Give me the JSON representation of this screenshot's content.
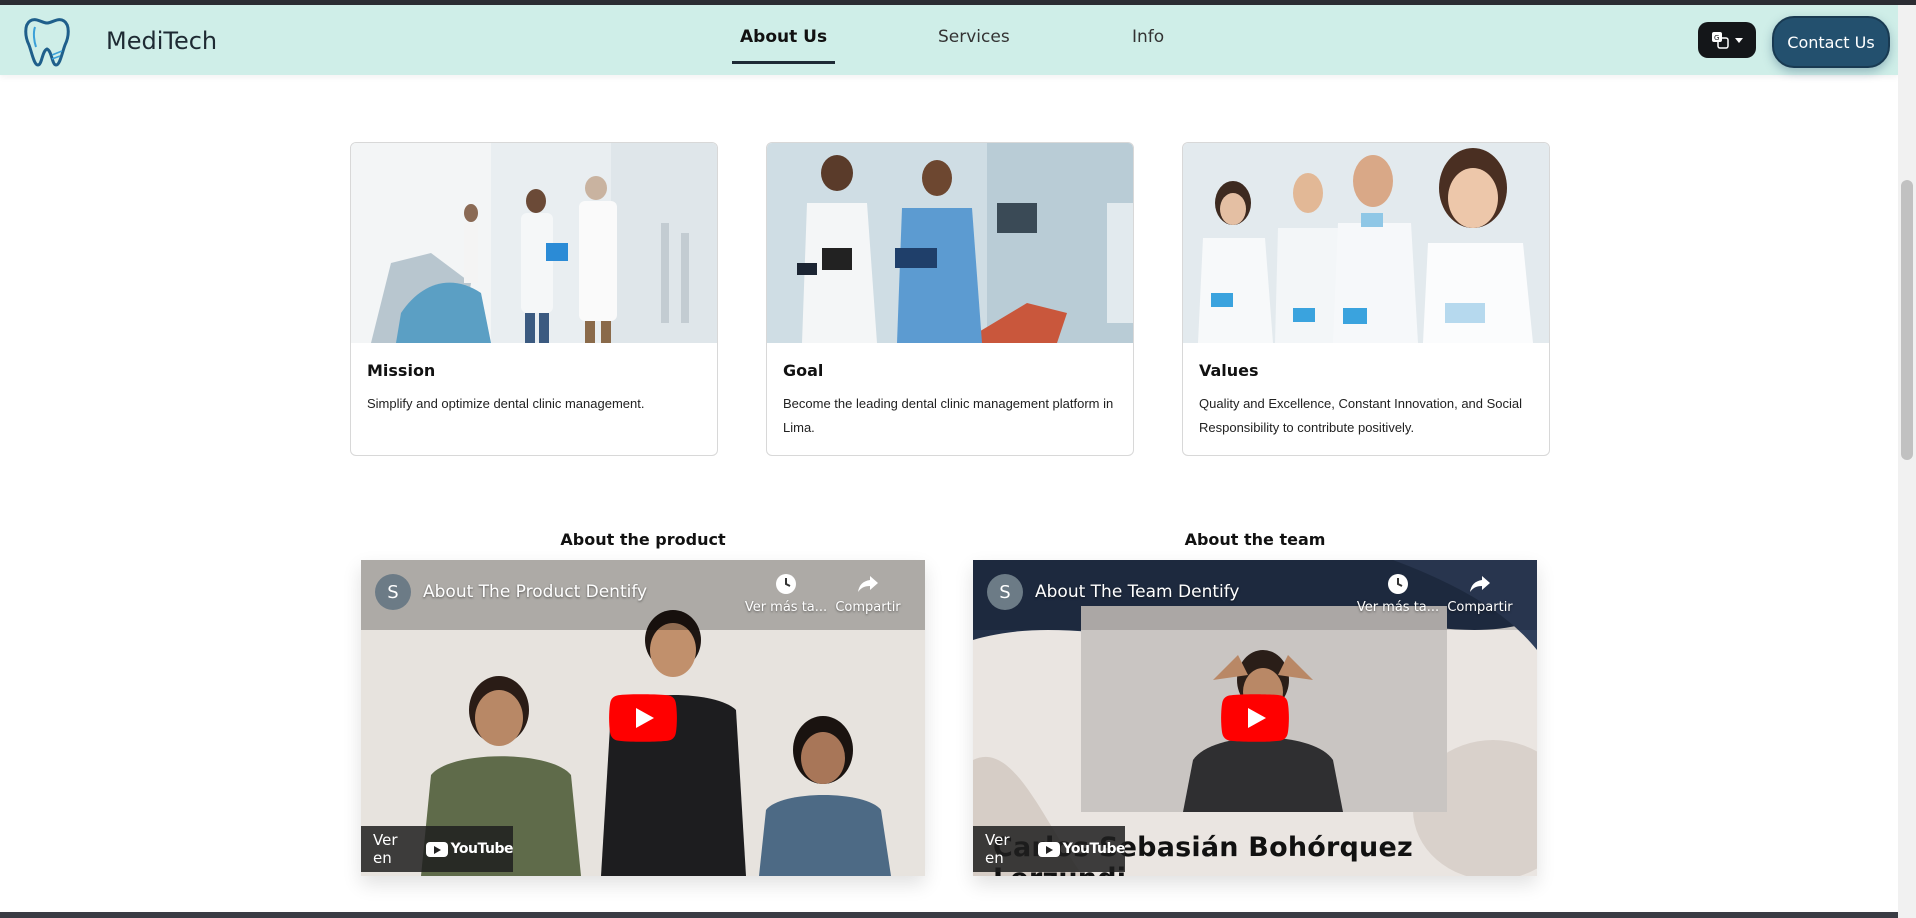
{
  "header": {
    "brand": "MediTech",
    "tabs": [
      {
        "label": "About Us",
        "active": true
      },
      {
        "label": "Services",
        "active": false
      },
      {
        "label": "Info",
        "active": false
      }
    ],
    "language_icon": "translate-icon",
    "contact_label": "Contact Us"
  },
  "cards": [
    {
      "title": "Mission",
      "text": "Simplify and optimize dental clinic management.",
      "image": "dental-clinic-staff-photo"
    },
    {
      "title": "Goal",
      "text": "Become the leading dental clinic management platform in Lima.",
      "image": "dental-nurses-photo"
    },
    {
      "title": "Values",
      "text": "Quality and Excellence, Constant Innovation, and Social Responsibility to contribute positively.",
      "image": "smiling-dental-team-photo"
    }
  ],
  "videos": [
    {
      "heading": "About the product",
      "channel_initial": "S",
      "title": "About The Product Dentify",
      "watch_later": "Ver más ta...",
      "share": "Compartir",
      "watch_on": "Ver en",
      "platform": "YouTube"
    },
    {
      "heading": "About the team",
      "channel_initial": "S",
      "title": "About The Team Dentify",
      "watch_later": "Ver más ta...",
      "share": "Compartir",
      "watch_on": "Ver en",
      "platform": "YouTube",
      "overlay_name": "Carlos Sebasián Bohórquez Lerzundi"
    }
  ],
  "colors": {
    "navbar": "#cfeee8",
    "contact_button": "#23506e",
    "youtube_red": "#ff0000"
  }
}
